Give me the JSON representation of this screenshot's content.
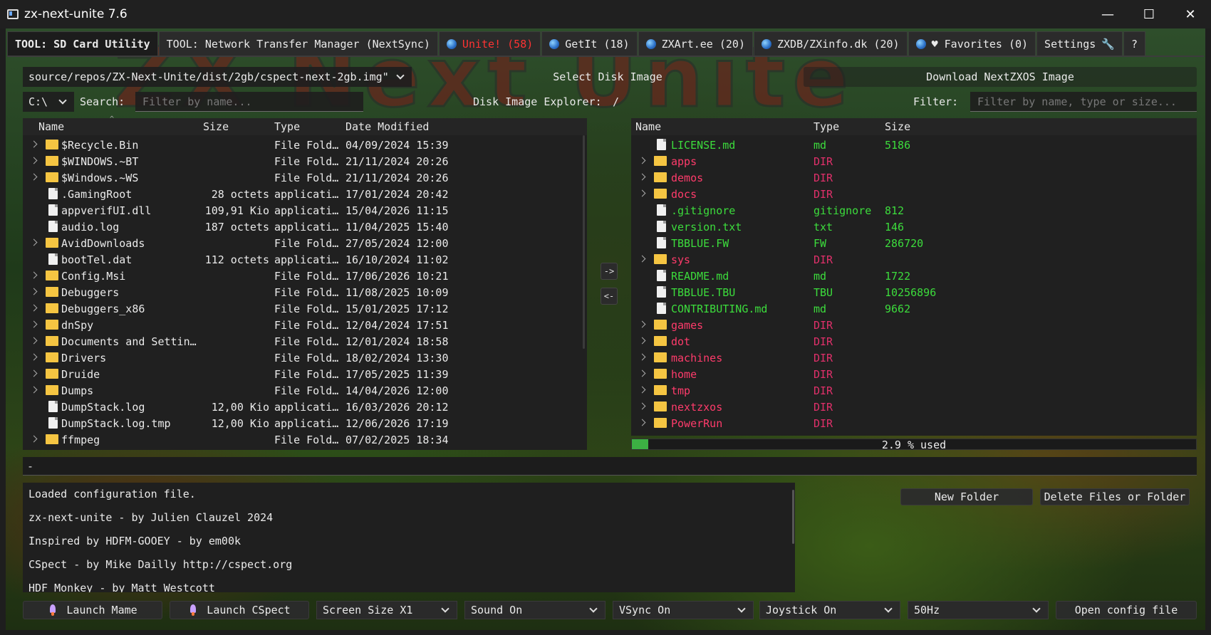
{
  "window": {
    "title": "zx-next-unite 7.6",
    "minimize": "—",
    "maximize": "☐",
    "close": "✕"
  },
  "background": {
    "logo_text": "ZX Next Unite"
  },
  "tabs": [
    {
      "label": "TOOL: SD Card Utility",
      "icon": ""
    },
    {
      "label": "TOOL: Network Transfer Manager (NextSync)",
      "icon": ""
    },
    {
      "label": "Unite! (58)",
      "icon": "globe-icon"
    },
    {
      "label": "GetIt (18)",
      "icon": "globe-icon"
    },
    {
      "label": "ZXArt.ee (20)",
      "icon": "globe-icon"
    },
    {
      "label": "ZXDB/ZXinfo.dk (20)",
      "icon": "globe-icon"
    },
    {
      "label": "♥ Favorites (0)",
      "icon": "globe-icon"
    },
    {
      "label": "Settings",
      "icon": "wrench-icon"
    },
    {
      "label": "?",
      "icon": ""
    }
  ],
  "toolbar": {
    "image_path": "source/repos/ZX-Next-Unite/dist/2gb/cspect-next-2gb.img\"",
    "select_disk_image": "Select Disk Image",
    "download_nextzxos": "Download NextZXOS Image"
  },
  "left": {
    "drive": "C:\\",
    "search_label": "Search:",
    "search_placeholder": "Filter by name...",
    "columns": {
      "name": "Name",
      "size": "Size",
      "type": "Type",
      "date": "Date Modified"
    },
    "rows": [
      {
        "name": "$Recycle.Bin",
        "size": "",
        "type": "File Fold…",
        "date": "04/09/2024 15:39",
        "kind": "folder"
      },
      {
        "name": "$WINDOWS.~BT",
        "size": "",
        "type": "File Fold…",
        "date": "21/11/2024 20:26",
        "kind": "folder"
      },
      {
        "name": "$Windows.~WS",
        "size": "",
        "type": "File Fold…",
        "date": "21/11/2024 20:26",
        "kind": "folder"
      },
      {
        "name": ".GamingRoot",
        "size": "28 octets",
        "type": "applicati…",
        "date": "17/01/2024 20:42",
        "kind": "file"
      },
      {
        "name": "appverifUI.dll",
        "size": "109,91 Kio",
        "type": "applicati…",
        "date": "15/04/2026 11:15",
        "kind": "file"
      },
      {
        "name": "audio.log",
        "size": "187 octets",
        "type": "applicati…",
        "date": "11/04/2025 15:40",
        "kind": "file"
      },
      {
        "name": "AvidDownloads",
        "size": "",
        "type": "File Fold…",
        "date": "27/05/2024 12:00",
        "kind": "folder"
      },
      {
        "name": "bootTel.dat",
        "size": "112 octets",
        "type": "applicati…",
        "date": "16/10/2024 11:02",
        "kind": "file"
      },
      {
        "name": "Config.Msi",
        "size": "",
        "type": "File Fold…",
        "date": "17/06/2026 10:21",
        "kind": "folder"
      },
      {
        "name": "Debuggers",
        "size": "",
        "type": "File Fold…",
        "date": "11/08/2025 10:09",
        "kind": "folder"
      },
      {
        "name": "Debuggers_x86",
        "size": "",
        "type": "File Fold…",
        "date": "15/01/2025 17:12",
        "kind": "folder"
      },
      {
        "name": "dnSpy",
        "size": "",
        "type": "File Fold…",
        "date": "12/04/2024 17:51",
        "kind": "folder"
      },
      {
        "name": "Documents and Settin…",
        "size": "",
        "type": "File Fold…",
        "date": "12/01/2024 18:58",
        "kind": "folder"
      },
      {
        "name": "Drivers",
        "size": "",
        "type": "File Fold…",
        "date": "18/02/2024 13:30",
        "kind": "folder"
      },
      {
        "name": "Druide",
        "size": "",
        "type": "File Fold…",
        "date": "17/05/2025 11:39",
        "kind": "folder"
      },
      {
        "name": "Dumps",
        "size": "",
        "type": "File Fold…",
        "date": "14/04/2026 12:00",
        "kind": "folder"
      },
      {
        "name": "DumpStack.log",
        "size": "12,00 Kio",
        "type": "applicati…",
        "date": "16/03/2026 20:12",
        "kind": "file"
      },
      {
        "name": "DumpStack.log.tmp",
        "size": "12,00 Kio",
        "type": "applicati…",
        "date": "12/06/2026 17:19",
        "kind": "file"
      },
      {
        "name": "ffmpeg",
        "size": "",
        "type": "File Fold…",
        "date": "07/02/2025 18:34",
        "kind": "folder"
      }
    ]
  },
  "transfer": {
    "to_right": "->",
    "to_left": "<-"
  },
  "right": {
    "explorer_label": "Disk Image Explorer:",
    "explorer_path": "/",
    "filter_label": "Filter:",
    "filter_placeholder": "Filter by name, type or size...",
    "columns": {
      "name": "Name",
      "type": "Type",
      "size": "Size"
    },
    "rows": [
      {
        "name": "LICENSE.md",
        "type": "md",
        "size": "5186",
        "kind": "file"
      },
      {
        "name": "apps",
        "type": "DIR",
        "size": "",
        "kind": "folder"
      },
      {
        "name": "demos",
        "type": "DIR",
        "size": "",
        "kind": "folder"
      },
      {
        "name": "docs",
        "type": "DIR",
        "size": "",
        "kind": "folder"
      },
      {
        "name": ".gitignore",
        "type": "gitignore",
        "size": "812",
        "kind": "file"
      },
      {
        "name": "version.txt",
        "type": "txt",
        "size": "146",
        "kind": "file"
      },
      {
        "name": "TBBLUE.FW",
        "type": "FW",
        "size": "286720",
        "kind": "file"
      },
      {
        "name": "sys",
        "type": "DIR",
        "size": "",
        "kind": "folder"
      },
      {
        "name": "README.md",
        "type": "md",
        "size": "1722",
        "kind": "file"
      },
      {
        "name": "TBBLUE.TBU",
        "type": "TBU",
        "size": "10256896",
        "kind": "file"
      },
      {
        "name": "CONTRIBUTING.md",
        "type": "md",
        "size": "9662",
        "kind": "file"
      },
      {
        "name": "games",
        "type": "DIR",
        "size": "",
        "kind": "folder"
      },
      {
        "name": "dot",
        "type": "DIR",
        "size": "",
        "kind": "folder"
      },
      {
        "name": "machines",
        "type": "DIR",
        "size": "",
        "kind": "folder"
      },
      {
        "name": "home",
        "type": "DIR",
        "size": "",
        "kind": "folder"
      },
      {
        "name": "tmp",
        "type": "DIR",
        "size": "",
        "kind": "folder"
      },
      {
        "name": "nextzxos",
        "type": "DIR",
        "size": "",
        "kind": "folder"
      },
      {
        "name": "PowerRun",
        "type": "DIR",
        "size": "",
        "kind": "folder"
      }
    ],
    "usage_fraction": 0.029,
    "usage_text": "2.9 % used"
  },
  "status": "-",
  "log_lines": [
    "Loaded configuration file.",
    "zx-next-unite - by Julien Clauzel 2024",
    "Inspired by HDFM-GOOEY - by em00k",
    "CSpect - by Mike Dailly http://cspect.org",
    "HDF Monkey - by Matt Westcott"
  ],
  "actions": {
    "new_folder": "New Folder",
    "delete": "Delete Files or Folder"
  },
  "bottom": {
    "launch_mame": "Launch Mame",
    "launch_cspect": "Launch CSpect",
    "screen_size": "Screen Size X1",
    "sound": "Sound On",
    "vsync": "VSync On",
    "joystick": "Joystick On",
    "refresh": "50Hz",
    "open_config": "Open config file"
  },
  "colors": {
    "file_name_green": "#3cdc3c",
    "dir_name_red": "#ff3b6b",
    "dir_type_pink": "#e0306a",
    "unite_tab_red": "#ff3333",
    "progress_green": "#3cb043"
  }
}
